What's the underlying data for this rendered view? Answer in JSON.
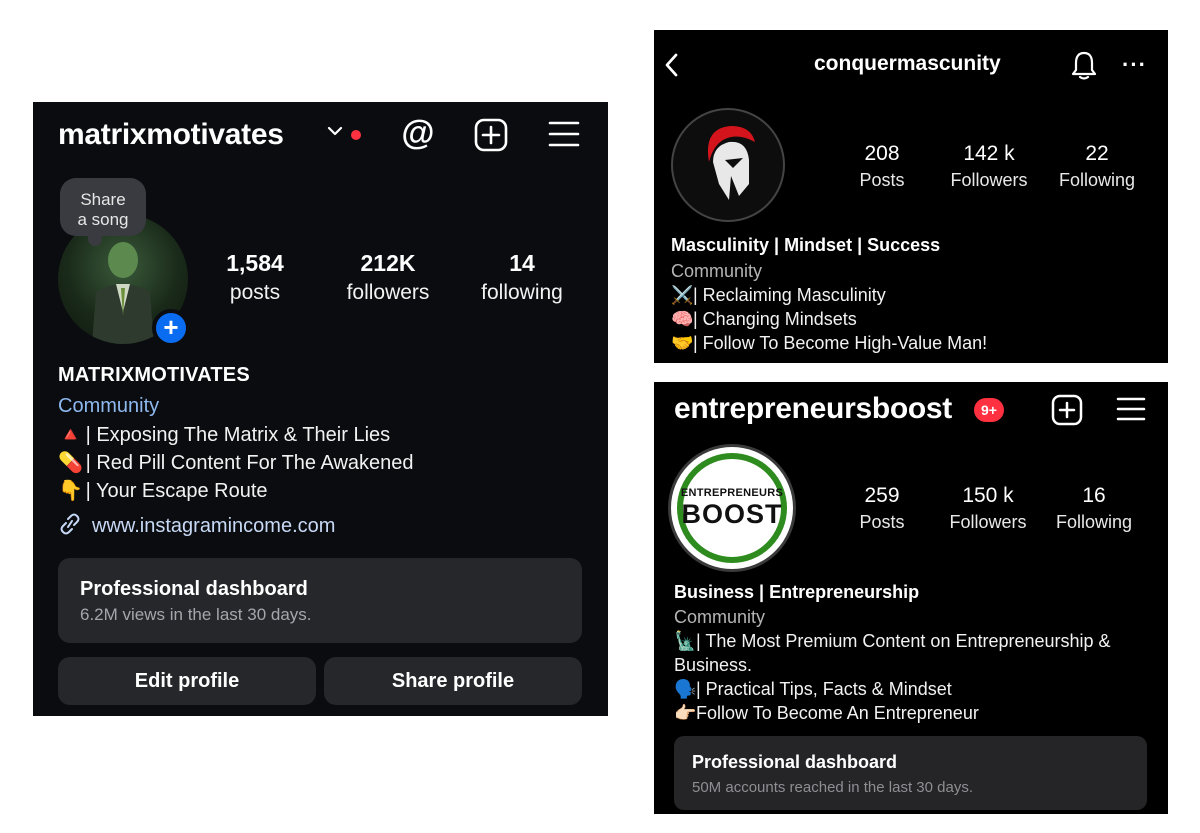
{
  "profile_1": {
    "username": "matrixmotivates",
    "note_bubble": "Share\na song",
    "stats": [
      {
        "value": "1,584",
        "label": "posts"
      },
      {
        "value": "212K",
        "label": "followers"
      },
      {
        "value": "14",
        "label": "following"
      }
    ],
    "display_name": "MATRIXMOTIVATES",
    "category": "Community",
    "bio_lines": [
      {
        "emoji": "🔺",
        "text": "| Exposing The Matrix & Their Lies"
      },
      {
        "emoji": "💊",
        "text": "| Red Pill Content For The Awakened"
      },
      {
        "emoji": "👇",
        "text": "| Your Escape Route"
      }
    ],
    "link": "www.instagramincome.com",
    "dashboard": {
      "title": "Professional dashboard",
      "subtitle": "6.2M views in the last 30 days."
    },
    "buttons": {
      "edit": "Edit profile",
      "share": "Share profile"
    },
    "colors": {
      "accent_link": "#8eb9ef",
      "notification_dot": "#ff3040",
      "add_badge": "#0a6cf0"
    },
    "icons": [
      "chevron-down-icon",
      "threads-icon",
      "new-post-icon",
      "menu-icon",
      "link-icon",
      "add-story-icon"
    ]
  },
  "profile_2": {
    "username": "conquermascunity",
    "stats": [
      {
        "value": "208",
        "label": "Posts"
      },
      {
        "value": "142 k",
        "label": "Followers"
      },
      {
        "value": "22",
        "label": "Following"
      }
    ],
    "display_name": "Masculinity | Mindset | Success",
    "category": "Community",
    "bio_lines": [
      {
        "emoji": "⚔️",
        "text": "| Reclaiming Masculinity"
      },
      {
        "emoji": "🧠",
        "text": "| Changing Mindsets"
      },
      {
        "emoji": "🤝",
        "text": "| Follow To Become High-Value Man!"
      }
    ],
    "icons": [
      "back-icon",
      "bell-icon",
      "more-icon"
    ]
  },
  "profile_3": {
    "username": "entrepreneursboost",
    "notification_badge": "9+",
    "avatar_logo": {
      "line1": "ENTREPRENEURS",
      "line2": "BOOST"
    },
    "stats": [
      {
        "value": "259",
        "label": "Posts"
      },
      {
        "value": "150 k",
        "label": "Followers"
      },
      {
        "value": "16",
        "label": "Following"
      }
    ],
    "display_name": "Business | Entrepreneurship",
    "category": "Community",
    "bio_lines": [
      {
        "emoji": "🗽",
        "text": "| The Most Premium Content on Entrepreneurship & Business."
      },
      {
        "emoji": "🗣️",
        "text": "| Practical Tips, Facts & Mindset"
      },
      {
        "emoji": "👉🏻",
        "text": "Follow To Become An Entrepreneur"
      }
    ],
    "dashboard": {
      "title": "Professional dashboard",
      "subtitle": "50M accounts reached in the last 30 days."
    },
    "icons": [
      "new-post-icon",
      "menu-icon"
    ]
  }
}
